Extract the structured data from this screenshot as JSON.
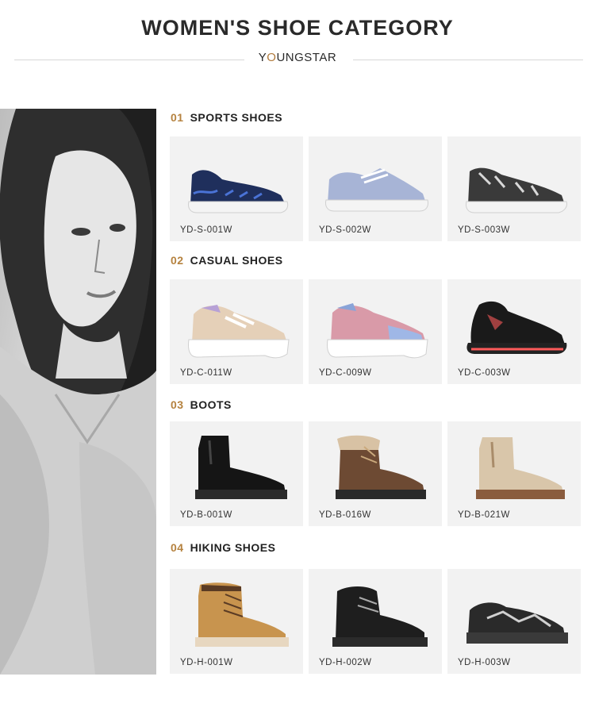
{
  "header": {
    "title": "WOMEN'S SHOE CATEGORY",
    "brand_before": "Y",
    "brand_o": "O",
    "brand_after": "UNGSTAR"
  },
  "sections": [
    {
      "number": "01",
      "title": "SPORTS SHOES",
      "items": [
        {
          "code": "YD-S-001W",
          "icon": "navy-knit-sneaker"
        },
        {
          "code": "YD-S-002W",
          "icon": "light-blue-lace-sneaker"
        },
        {
          "code": "YD-S-003W",
          "icon": "black-knit-slip-on"
        }
      ]
    },
    {
      "number": "02",
      "title": "CASUAL SHOES",
      "items": [
        {
          "code": "YD-C-011W",
          "icon": "beige-chunky-sneaker"
        },
        {
          "code": "YD-C-009W",
          "icon": "pink-chunky-sneaker"
        },
        {
          "code": "YD-C-003W",
          "icon": "black-sock-sneaker"
        }
      ]
    },
    {
      "number": "03",
      "title": "BOOTS",
      "items": [
        {
          "code": "YD-B-001W",
          "icon": "black-chelsea-boot"
        },
        {
          "code": "YD-B-016W",
          "icon": "brown-fur-lace-boot"
        },
        {
          "code": "YD-B-021W",
          "icon": "gold-chelsea-boot"
        }
      ]
    },
    {
      "number": "04",
      "title": "HIKING SHOES",
      "items": [
        {
          "code": "YD-H-001W",
          "icon": "tan-work-boot"
        },
        {
          "code": "YD-H-002W",
          "icon": "black-hiking-boot"
        },
        {
          "code": "YD-H-003W",
          "icon": "black-hiking-shoe"
        }
      ]
    }
  ],
  "colors": {
    "accent": "#b5823f",
    "card_bg": "#f2f2f2"
  }
}
